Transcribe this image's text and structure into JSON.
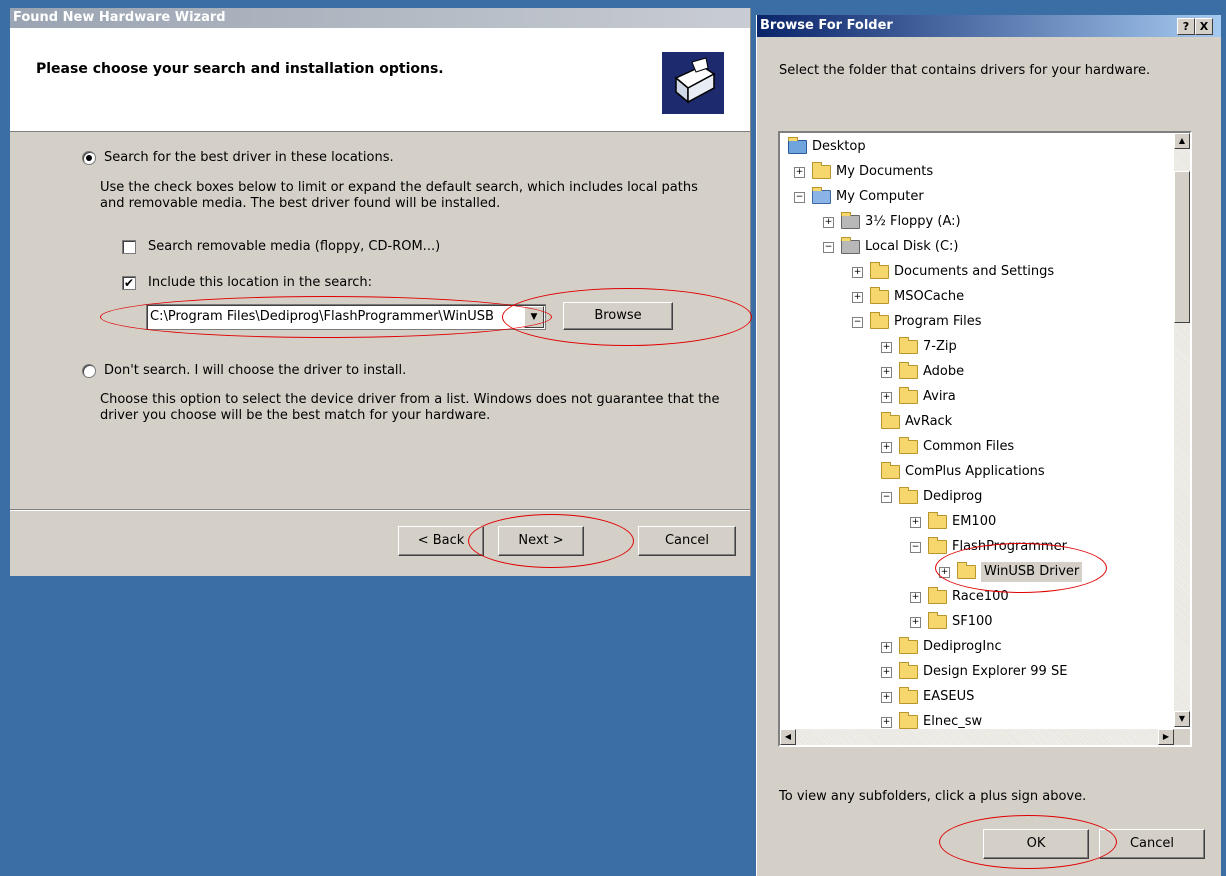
{
  "wizard": {
    "title": "Found New Hardware Wizard",
    "header_title": "Please choose your search and installation options.",
    "option_search": "Search for the best driver in these locations.",
    "search_desc": "Use the check boxes below to limit or expand the default search, which includes local paths and removable media. The best driver found will be installed.",
    "check_removable": "Search removable media (floppy, CD-ROM...)",
    "check_include": "Include this location in the search:",
    "location_value": "C:\\Program Files\\Dediprog\\FlashProgrammer\\WinUSB",
    "browse_label": "Browse",
    "option_dont_search": "Don't search. I will choose the driver to install.",
    "dont_search_desc": "Choose this option to select the device driver from a list.  Windows does not guarantee that the driver you choose will be the best match for your hardware.",
    "back_label": "< Back",
    "next_label": "Next >",
    "cancel_label": "Cancel"
  },
  "browse": {
    "title": "Browse For Folder",
    "help_btn": "?",
    "close_btn": "X",
    "instruction": "Select the folder that contains drivers for your hardware.",
    "tree": [
      {
        "label": "Desktop",
        "icon": "desktop-icon"
      },
      {
        "label": "My Documents",
        "icon": "folder-icon",
        "pm": "+"
      },
      {
        "label": "My Computer",
        "icon": "computer-icon",
        "pm": "−"
      },
      {
        "label": "3½ Floppy (A:)",
        "icon": "floppy-icon",
        "pm": "+"
      },
      {
        "label": "Local Disk (C:)",
        "icon": "drive-icon",
        "pm": "−"
      },
      {
        "label": "Documents and Settings",
        "icon": "folder-icon",
        "pm": "+"
      },
      {
        "label": "MSOCache",
        "icon": "folder-icon",
        "pm": "+"
      },
      {
        "label": "Program Files",
        "icon": "folder-icon",
        "pm": "−"
      },
      {
        "label": "7-Zip",
        "icon": "folder-icon",
        "pm": "+"
      },
      {
        "label": "Adobe",
        "icon": "folder-icon",
        "pm": "+"
      },
      {
        "label": "Avira",
        "icon": "folder-icon",
        "pm": "+"
      },
      {
        "label": "AvRack",
        "icon": "folder-icon"
      },
      {
        "label": "Common Files",
        "icon": "folder-icon",
        "pm": "+"
      },
      {
        "label": "ComPlus Applications",
        "icon": "folder-icon"
      },
      {
        "label": "Dediprog",
        "icon": "folder-icon",
        "pm": "−"
      },
      {
        "label": "EM100",
        "icon": "folder-icon",
        "pm": "+"
      },
      {
        "label": "FlashProgrammer",
        "icon": "folder-icon",
        "pm": "−"
      },
      {
        "label": "WinUSB Driver",
        "icon": "folder-icon",
        "pm": "+",
        "selected": true
      },
      {
        "label": "Race100",
        "icon": "folder-icon",
        "pm": "+"
      },
      {
        "label": "SF100",
        "icon": "folder-icon",
        "pm": "+"
      },
      {
        "label": "DediprogInc",
        "icon": "folder-icon",
        "pm": "+"
      },
      {
        "label": "Design Explorer 99 SE",
        "icon": "folder-icon",
        "pm": "+"
      },
      {
        "label": "EASEUS",
        "icon": "folder-icon",
        "pm": "+"
      },
      {
        "label": "Elnec_sw",
        "icon": "folder-icon",
        "pm": "+"
      }
    ],
    "footer_hint": "To view any subfolders, click a plus sign above.",
    "ok_label": "OK",
    "cancel_label": "Cancel"
  },
  "colors": {
    "desktop": "#3a6ea5",
    "dialog": "#d4d0c8",
    "highlight_ring": "#e00000",
    "active_title": "#0a246a"
  }
}
